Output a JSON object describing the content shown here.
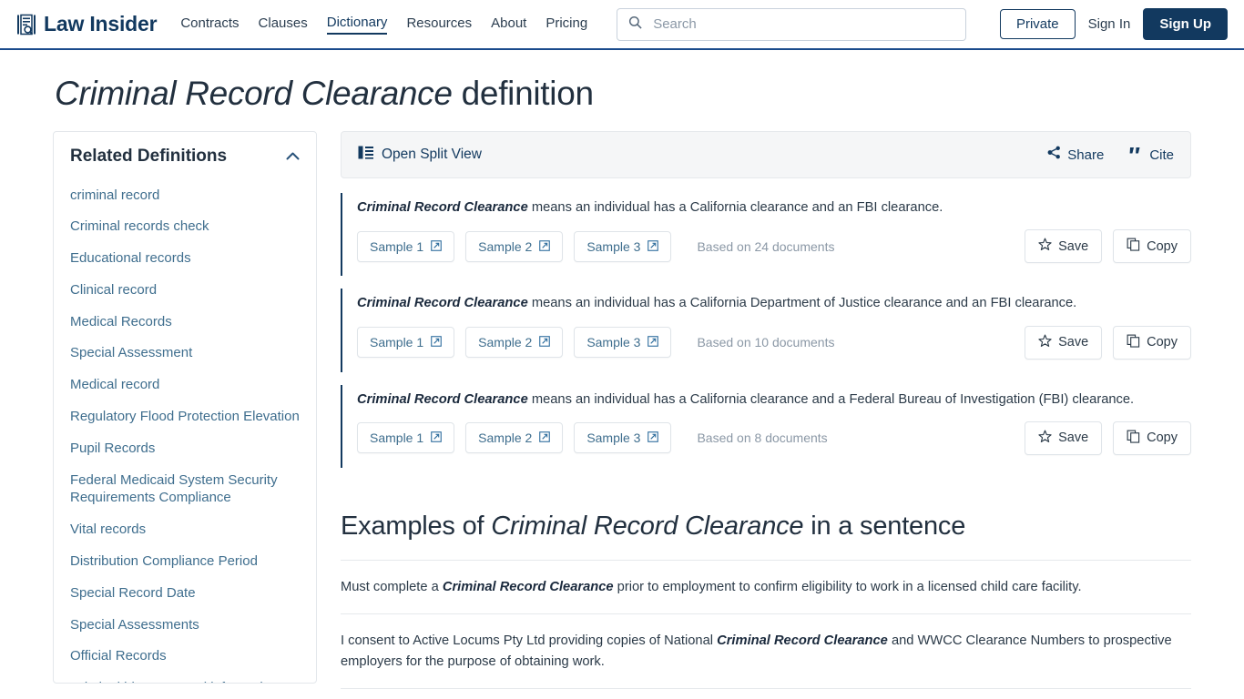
{
  "header": {
    "brand": "Law Insider",
    "logo_icon": "document-search-icon",
    "nav": [
      {
        "label": "Contracts",
        "active": false
      },
      {
        "label": "Clauses",
        "active": false
      },
      {
        "label": "Dictionary",
        "active": true
      },
      {
        "label": "Resources",
        "active": false
      },
      {
        "label": "About",
        "active": false
      },
      {
        "label": "Pricing",
        "active": false
      }
    ],
    "search": {
      "placeholder": "Search",
      "value": "",
      "icon": "search-icon"
    },
    "private_label": "Private",
    "signin_label": "Sign In",
    "signup_label": "Sign Up",
    "accent_color": "#12395f"
  },
  "page": {
    "term": "Criminal Record Clearance",
    "title_suffix": " definition"
  },
  "sidebar": {
    "title": "Related Definitions",
    "collapse_icon": "chevron-up-icon",
    "items": [
      "criminal record",
      "Criminal records check",
      "Educational records",
      "Clinical record",
      "Medical Records",
      "Special Assessment",
      "Medical record",
      "Regulatory Flood Protection Elevation",
      "Pupil Records",
      "Federal Medicaid System Security Requirements Compliance",
      "Vital records",
      "Distribution Compliance Period",
      "Special Record Date",
      "Special Assessments",
      "Official Records",
      "Criminal history record information"
    ]
  },
  "toolbar": {
    "split_view_label": "Open Split View",
    "split_view_icon": "split-view-icon",
    "share_label": "Share",
    "share_icon": "share-icon",
    "cite_label": "Cite",
    "cite_icon": "quote-icon"
  },
  "definitions": [
    {
      "term": "Criminal Record Clearance",
      "text": " means an individual has a California clearance and an FBI clearance.",
      "samples": [
        "Sample 1",
        "Sample 2",
        "Sample 3"
      ],
      "sample_icon": "external-link-icon",
      "based_on": "Based on 24 documents",
      "save_label": "Save",
      "save_icon": "star-icon",
      "copy_label": "Copy",
      "copy_icon": "copy-icon"
    },
    {
      "term": "Criminal Record Clearance",
      "text": " means an individual has a California Department of Justice clearance and an FBI clearance.",
      "samples": [
        "Sample 1",
        "Sample 2",
        "Sample 3"
      ],
      "sample_icon": "external-link-icon",
      "based_on": "Based on 10 documents",
      "save_label": "Save",
      "save_icon": "star-icon",
      "copy_label": "Copy",
      "copy_icon": "copy-icon"
    },
    {
      "term": "Criminal Record Clearance",
      "text": " means an individual has a California clearance and a Federal Bureau of Investigation (FBI) clearance.",
      "samples": [
        "Sample 1",
        "Sample 2",
        "Sample 3"
      ],
      "sample_icon": "external-link-icon",
      "based_on": "Based on 8 documents",
      "save_label": "Save",
      "save_icon": "star-icon",
      "copy_label": "Copy",
      "copy_icon": "copy-icon"
    }
  ],
  "examples": {
    "heading_prefix": "Examples of ",
    "heading_term": "Criminal Record Clearance",
    "heading_suffix": " in a sentence",
    "items": [
      {
        "pre": "Must complete a ",
        "term": "Criminal Record Clearance",
        "post": " prior to employment to confirm eligibility to work in a licensed child care facility."
      },
      {
        "pre": "I consent to Active Locums Pty Ltd providing copies of National ",
        "term": "Criminal Record Clearance",
        "post": " and WWCC Clearance Numbers to prospective employers for the purpose of obtaining work."
      }
    ]
  }
}
